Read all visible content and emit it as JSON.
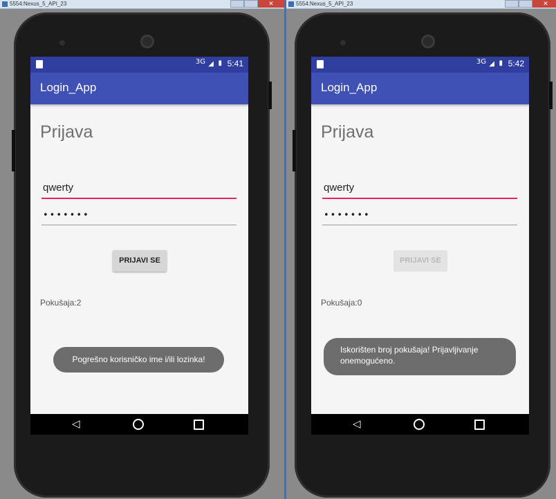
{
  "left": {
    "window_title": "5554:Nexus_5_API_23",
    "status": {
      "signal_label": "3G",
      "time": "5:41"
    },
    "app_title": "Login_App",
    "heading": "Prijava",
    "username_value": "qwerty",
    "password_value": "•••••••",
    "login_button": {
      "label": "PRIJAVI SE",
      "state": "enabled"
    },
    "attempts_text": "Pokušaja:2",
    "toast": "Pogrešno korisničko ime i/ili lozinka!"
  },
  "right": {
    "window_title": "5554:Nexus_5_API_23",
    "status": {
      "signal_label": "3G",
      "time": "5:42"
    },
    "app_title": "Login_App",
    "heading": "Prijava",
    "username_value": "qwerty",
    "password_value": "•••••••",
    "login_button": {
      "label": "PRIJAVI SE",
      "state": "disabled"
    },
    "attempts_text": "Pokušaja:0",
    "toast": "Iskorišten broj pokušaja! Prijavljivanje onemogućeno."
  },
  "colors": {
    "status_bar": "#303f9f",
    "app_bar": "#3f51b5",
    "field_focus_underline": "#e91e63",
    "toast_bg": "#6d6d6d"
  },
  "icons": {
    "status": [
      "sim-card-icon",
      "signal-3g-icon",
      "battery-icon"
    ],
    "navigation": [
      "back-icon",
      "home-icon",
      "recent-apps-icon"
    ]
  }
}
